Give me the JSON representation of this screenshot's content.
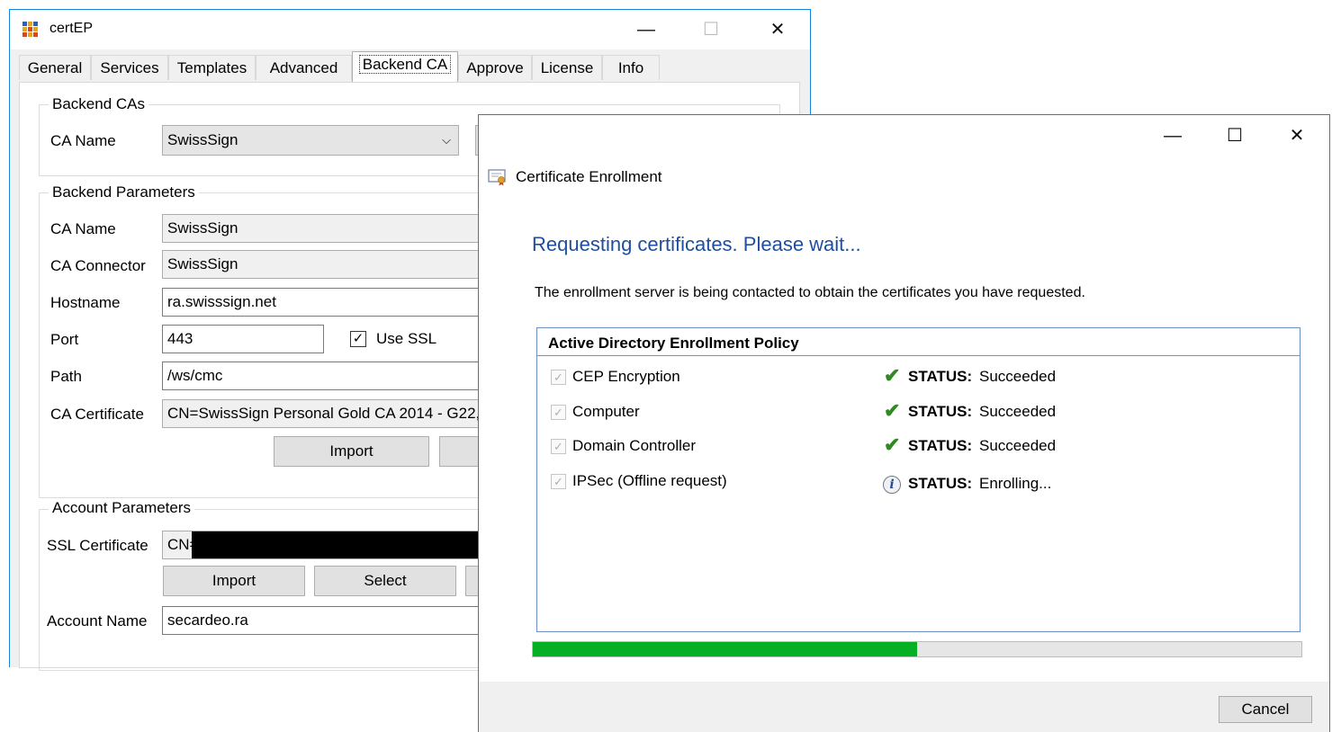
{
  "certep": {
    "title": "certEP",
    "controls": {
      "minimize": "—",
      "maximize": "☐",
      "close": "✕"
    },
    "tabs": [
      "General",
      "Services",
      "Templates",
      "Advanced",
      "Backend CA",
      "Approve",
      "License",
      "Info"
    ],
    "active_tab": "Backend CA",
    "backend_cas": {
      "group_title": "Backend CAs",
      "ca_name_label": "CA Name",
      "ca_name_value": "SwissSign"
    },
    "backend_params": {
      "group_title": "Backend Parameters",
      "ca_name_label": "CA Name",
      "ca_name_value": "SwissSign",
      "connector_label": "CA Connector",
      "connector_value": "SwissSign",
      "hostname_label": "Hostname",
      "hostname_value": "ra.swisssign.net",
      "port_label": "Port",
      "port_value": "443",
      "use_ssl_label": "Use SSL",
      "use_ssl_checked": true,
      "path_label": "Path",
      "path_value": "/ws/cmc",
      "ca_cert_label": "CA Certificate",
      "ca_cert_value": "CN=SwissSign Personal Gold CA 2014 - G22,",
      "import_button": "Import"
    },
    "account_params": {
      "group_title": "Account Parameters",
      "ssl_cert_label": "SSL Certificate",
      "ssl_cert_value": "CN=",
      "import_button": "Import",
      "select_button": "Select",
      "account_name_label": "Account Name",
      "account_name_value": "secardeo.ra"
    }
  },
  "enroll": {
    "controls": {
      "minimize": "—",
      "maximize": "☐",
      "close": "✕"
    },
    "title": "Certificate Enrollment",
    "heading": "Requesting certificates. Please wait...",
    "description": "The enrollment server is being contacted to obtain the certificates you have requested.",
    "policy_title": "Active Directory Enrollment Policy",
    "status_label": "STATUS:",
    "items": [
      {
        "name": "CEP Encryption",
        "status": "Succeeded",
        "icon": "check-icon"
      },
      {
        "name": "Computer",
        "status": "Succeeded",
        "icon": "check-icon"
      },
      {
        "name": "Domain Controller",
        "status": "Succeeded",
        "icon": "check-icon"
      },
      {
        "name": "IPSec (Offline request)",
        "status": "Enrolling...",
        "icon": "info-icon"
      }
    ],
    "progress": 0.5,
    "cancel_button": "Cancel"
  }
}
